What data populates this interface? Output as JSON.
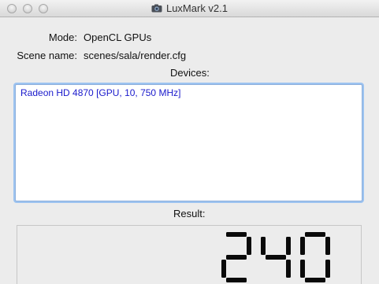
{
  "window": {
    "title": "LuxMark v2.1",
    "icon": "luxmark-camera-icon"
  },
  "info": {
    "mode_label": "Mode:",
    "mode_value": "OpenCL GPUs",
    "scene_label": "Scene name:",
    "scene_value": "scenes/sala/render.cfg"
  },
  "devices": {
    "label": "Devices:",
    "items": [
      "Radeon HD 4870 [GPU, 10, 750 MHz]"
    ]
  },
  "result": {
    "label": "Result:",
    "value": "240"
  },
  "colors": {
    "device_text": "#1a1acc",
    "focus_ring": "#9cc3f0",
    "lcd_digits": "#0a0a0a"
  }
}
